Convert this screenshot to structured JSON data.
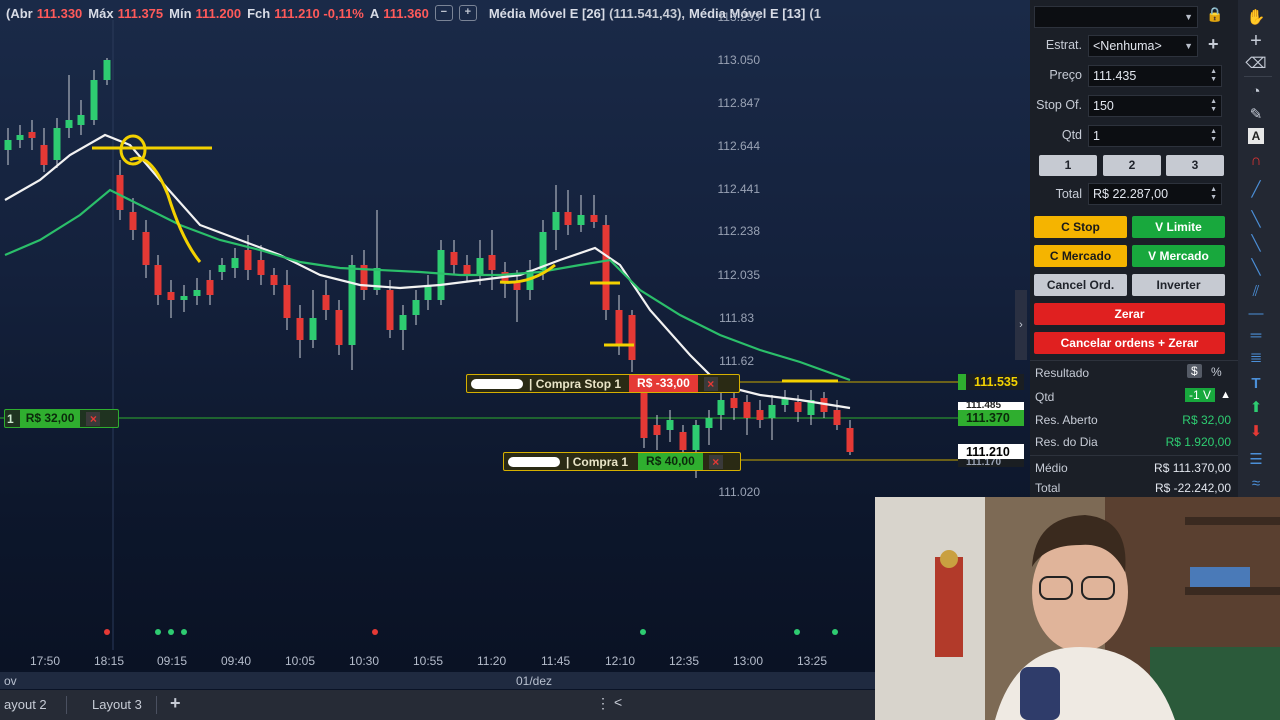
{
  "header": {
    "abr_label": "(Abr",
    "abr_value": "111.330",
    "max_label": "Máx",
    "max_value": "111.375",
    "min_label": "Mín",
    "min_value": "111.200",
    "fch_label": "Fch",
    "fch_value": "111.210 -0,11%",
    "a_label": "A",
    "a_value": "111.360",
    "btn_minus": "−",
    "btn_plus": "+",
    "ma1_label": "Média Móvel E [26]",
    "ma1_value": "(111.541,43),",
    "ma2_label": "Média Móvel E [13]",
    "ma2_value": "(1"
  },
  "price_axis": [
    "113.253",
    "113.050",
    "112.847",
    "112.644",
    "112.441",
    "112.238",
    "112.035",
    "111.83",
    "111.62",
    "111.020"
  ],
  "price_tags": {
    "stop_price": "111.535",
    "hidden_price": "111.485",
    "position_price": "111.370",
    "last_price": "111.210",
    "buy_price_hidden": "111.170"
  },
  "orders": {
    "stop": {
      "label": "| Compra Stop 1",
      "value": "R$ -33,00",
      "close": "×"
    },
    "limit": {
      "label": "| Compra 1",
      "value": "R$ 40,00",
      "close": "×"
    },
    "position": {
      "qty": "1",
      "value": "R$ 32,00",
      "close": "×"
    }
  },
  "time_axis": [
    "17:50",
    "18:15",
    "09:15",
    "09:40",
    "10:05",
    "10:30",
    "10:55",
    "11:20",
    "11:45",
    "12:10",
    "12:35",
    "13:00",
    "13:25"
  ],
  "date_strip": {
    "left": "ov",
    "center": "01/dez"
  },
  "tabs": {
    "layout2": "ayout 2",
    "layout3": "Layout 3",
    "add": "+",
    "menu": "⋮",
    "collapse": "<"
  },
  "panel": {
    "lock_icon": "🔒",
    "estrat_label": "Estrat.",
    "estrat_value": "<Nenhuma>",
    "preco_label": "Preço",
    "preco_value": "111.435",
    "stop_label": "Stop Of.",
    "stop_value": "150",
    "qtd_label": "Qtd",
    "qtd_value": "1",
    "qty_buttons": [
      "1",
      "2",
      "3"
    ],
    "total_label": "Total",
    "total_value": "R$ 22.287,00",
    "c_stop": "C Stop",
    "v_limite": "V Limite",
    "c_mercado": "C Mercado",
    "v_mercado": "V Mercado",
    "cancel_ord": "Cancel Ord.",
    "inverter": "Inverter",
    "zerar": "Zerar",
    "cancelar_zerar": "Cancelar ordens + Zerar",
    "resultado_label": "Resultado",
    "dollar": "$",
    "percent": "%",
    "res_qtd_label": "Qtd",
    "res_qtd_value": "-1 V",
    "res_aberto_label": "Res. Aberto",
    "res_aberto_value": "R$ 32,00",
    "res_dia_label": "Res. do Dia",
    "res_dia_value": "R$ 1.920,00",
    "medio_label": "Médio",
    "medio_value": "R$ 111.370,00",
    "total2_label": "Total",
    "total2_value": "R$ -22.242,00"
  },
  "colors": {
    "green": "#2ecc71",
    "red": "#e53935",
    "yellow": "#f3d100",
    "ma_white": "#f2f2f2",
    "ma_green": "#2bbf6a"
  }
}
